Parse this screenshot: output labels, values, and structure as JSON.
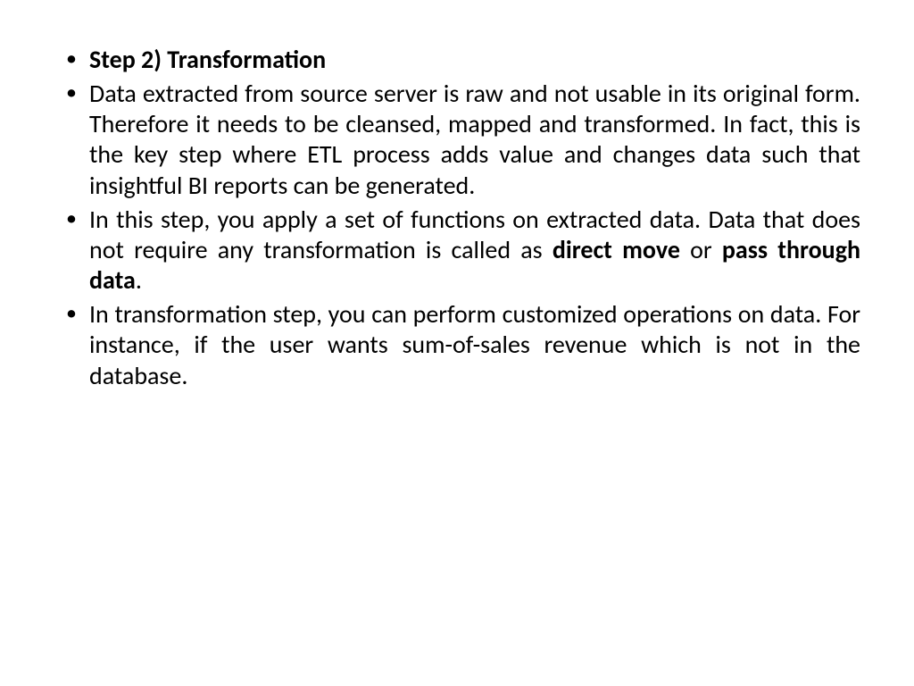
{
  "bullets": [
    {
      "heading": "Step 2) Transformation"
    },
    {
      "text": "Data extracted from source server is raw and not usable in its original form. Therefore it needs to be cleansed, mapped and transformed. In fact, this is the key step where ETL process adds value and changes data such that insightful BI reports can be generated."
    },
    {
      "pre": "In this step, you apply a set of functions on extracted data. Data that does not require any transformation is called as ",
      "bold1": "direct move",
      "mid": " or ",
      "bold2": "pass through data",
      "post": "."
    },
    {
      "text": "In transformation step, you can perform customized operations on data. For instance, if the user wants sum-of-sales revenue which is not in the database."
    }
  ]
}
